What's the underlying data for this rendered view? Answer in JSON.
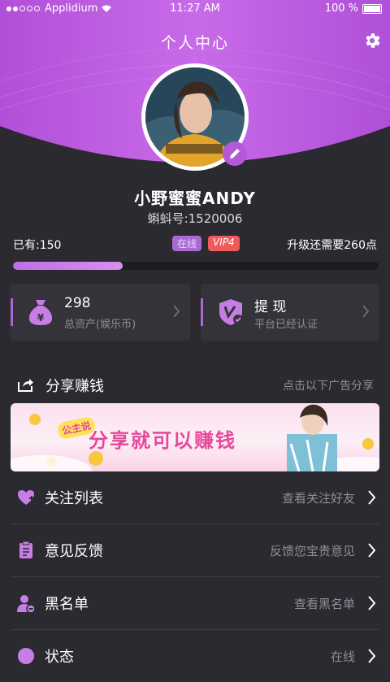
{
  "status_bar": {
    "carrier": "Applidium",
    "time": "11:27 AM",
    "battery": "100 %"
  },
  "header": {
    "title": "个人中心"
  },
  "profile": {
    "name": "小野蜜蜜ANDY",
    "id_text": "蝌蚪号:1520006"
  },
  "level": {
    "have": "已有:150",
    "online_badge": "在线",
    "vip_badge": "VIP4",
    "need": "升级还需要260点",
    "progress": 0.3
  },
  "cards": [
    {
      "title": "298",
      "sub": "总资产(娱乐币)",
      "icon": "money-bag-icon"
    },
    {
      "title": "提 现",
      "sub": "平台已经认证",
      "icon": "verified-shield-icon"
    }
  ],
  "share": {
    "label": "分享赚钱",
    "hint": "点击以下广告分享",
    "banner_text": "分享就可以赚钱",
    "banner_tag": "公主说"
  },
  "list": [
    {
      "label": "关注列表",
      "hint": "查看关注好友",
      "icon": "heart-plus-icon"
    },
    {
      "label": "意见反馈",
      "hint": "反馈您宝贵意见",
      "icon": "clipboard-icon"
    },
    {
      "label": "黑名单",
      "hint": "查看黑名单",
      "icon": "user-block-icon"
    },
    {
      "label": "状态",
      "hint": "在线",
      "icon": "status-icon"
    }
  ],
  "colors": {
    "accent": "#b45ad8",
    "bg": "#2b2a30",
    "vip": "#ef5b5b"
  }
}
